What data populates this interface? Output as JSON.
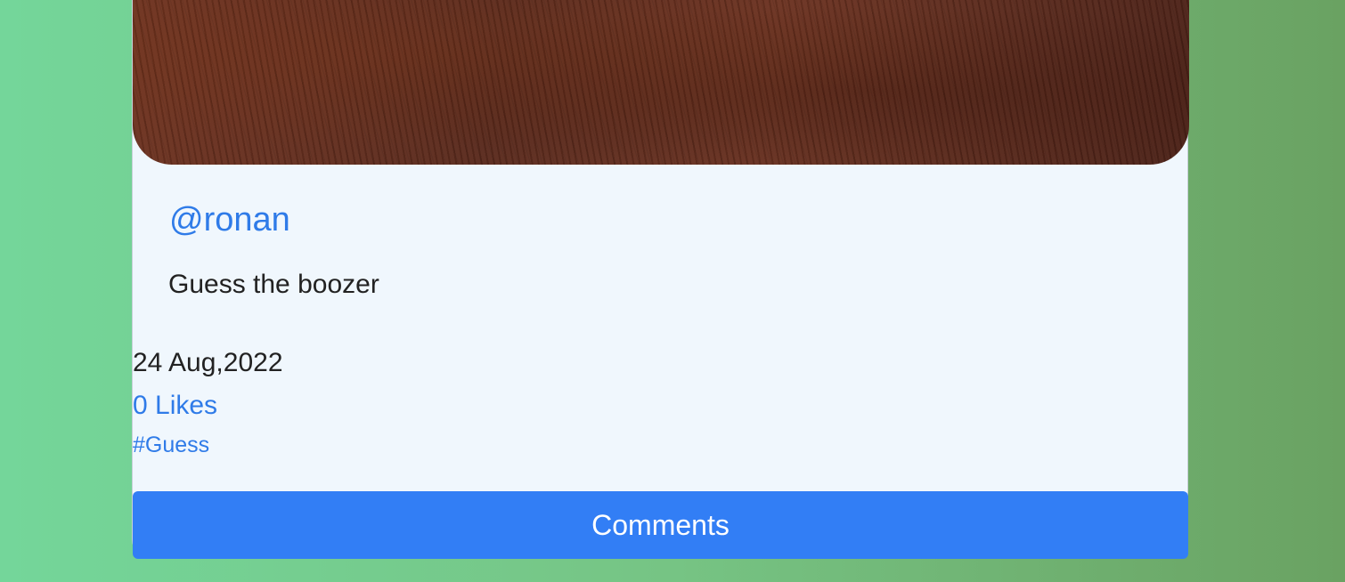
{
  "post": {
    "username": "@ronan",
    "caption": "Guess the boozer",
    "date": "24 Aug,2022",
    "likes": "0 Likes",
    "hashtag": "#Guess",
    "comments_label": "Comments",
    "image": "wood-grain-photo"
  },
  "colors": {
    "accent": "#327ef5",
    "link": "#2f7be8",
    "card_bg": "#f0f7fd",
    "bg_start": "#74d69a",
    "bg_end": "#6aa262"
  }
}
